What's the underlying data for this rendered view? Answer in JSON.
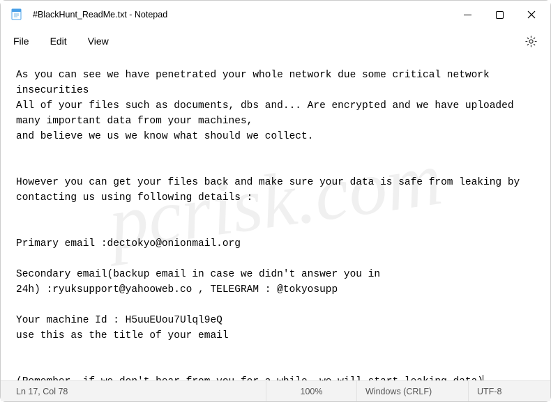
{
  "titlebar": {
    "title": "#BlackHunt_ReadMe.txt - Notepad",
    "icons": {
      "app": "notepad-icon",
      "minimize": "minimize-icon",
      "maximize": "maximize-icon",
      "close": "close-icon"
    }
  },
  "menubar": {
    "file": "File",
    "edit": "Edit",
    "view": "View",
    "settings_icon": "gear-icon"
  },
  "content": {
    "text": "As you can see we have penetrated your whole network due some critical network insecurities\nAll of your files such as documents, dbs and... Are encrypted and we have uploaded many important data from your machines,\nand believe we us we know what should we collect.\n\n\nHowever you can get your files back and make sure your data is safe from leaking by contacting us using following details :\n\n\nPrimary email :dectokyo@onionmail.org\n\nSecondary email(backup email in case we didn't answer you in\n24h) :ryuksupport@yahooweb.co , TELEGRAM : @tokyosupp\n\nYour machine Id : H5uuEUou7Ulql9eQ\nuse this as the title of your email\n\n\n(Remember, if we don't hear from you for a while, we will start leaking data)"
  },
  "statusbar": {
    "position": "Ln 17, Col 78",
    "zoom": "100%",
    "lineending": "Windows (CRLF)",
    "encoding": "UTF-8"
  },
  "watermark": "pcrisk.com"
}
